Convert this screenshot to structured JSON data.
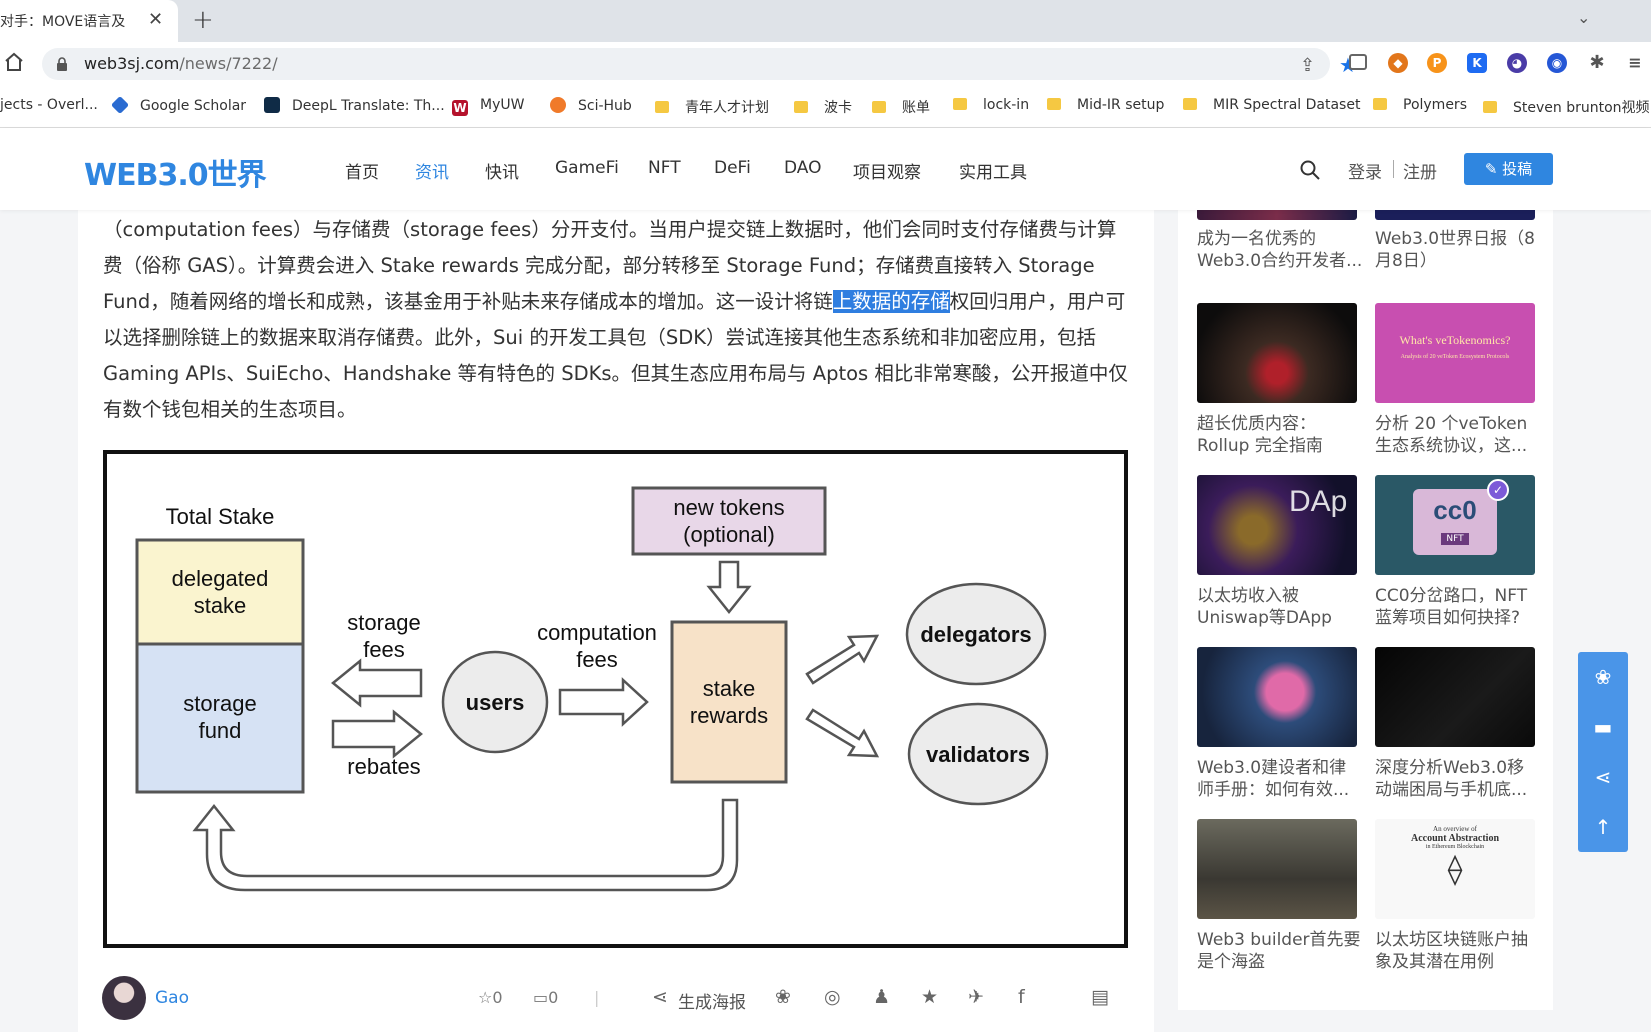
{
  "browser": {
    "tab_title": "对手：MOVE语言及",
    "url_domain": "web3sj.com",
    "url_path": "/news/7222/",
    "bookmarks": [
      "jects - Overl...",
      "Google Scholar",
      "DeepL Translate: Th...",
      "MyUW",
      "Sci-Hub",
      "青年人才计划",
      "波卡",
      "账单",
      "lock-in",
      "Mid-IR setup",
      "MIR Spectral Dataset",
      "Polymers",
      "Steven brunton视频"
    ]
  },
  "site": {
    "logo": "WEB3.0世界",
    "nav": [
      "首页",
      "资讯",
      "快讯",
      "GameFi",
      "NFT",
      "DeFi",
      "DAO",
      "项目观察",
      "实用工具"
    ],
    "login": "登录",
    "register": "注册",
    "submit": "投稿"
  },
  "article": {
    "p_before": "（computation fees）与存储费（storage fees）分开支付。当用户提交链上数据时，他们会同时支付存储费与计算费（俗称 GAS）。计算费会进入 Stake rewards 完成分配，部分转移至 Storage Fund；存储费直接转入 Storage Fund，随着网络的增长和成熟，该基金用于补贴未来存储成本的增加。这一设计将链",
    "p_highlight": "上数据的存储",
    "p_after": "权回归用户，用户可以选择删除链上的数据来取消存储费。此外，Sui 的开发工具包（SDK）尝试连接其他生态系统和非加密应用，包括 Gaming APIs、SuiEcho、Handshake 等有特色的 SDKs。但其生态应用布局与 Aptos 相比非常寒酸，公开报道中仅有数个钱包相关的生态项目。",
    "diagram": {
      "total_stake": "Total Stake",
      "delegated_1": "delegated",
      "delegated_2": "stake",
      "storage_1": "storage",
      "storage_2": "fund",
      "storage_fees_1": "storage",
      "storage_fees_2": "fees",
      "rebates": "rebates",
      "users": "users",
      "computation_1": "computation",
      "computation_2": "fees",
      "new_tokens_1": "new tokens",
      "new_tokens_2": "(optional)",
      "stake_rewards_1": "stake",
      "stake_rewards_2": "rewards",
      "delegators": "delegators",
      "validators": "validators"
    },
    "author": "Gao",
    "star_count": "0",
    "comment_count": "0",
    "poster": "生成海报"
  },
  "sidebar": {
    "top_cards": [
      "成为一名优秀的Web3.0合约开发者...",
      "Web3.0世界日报（8月8日）"
    ],
    "cards": [
      {
        "title": "超长优质内容：Rollup 完全指南"
      },
      {
        "title": "分析 20 个veToken 生态系统协议，这..."
      },
      {
        "title": "以太坊收入被Uniswap等DApp超..."
      },
      {
        "title": "CC0分岔路口，NFT蓝筹项目如何抉择?"
      },
      {
        "title": "Web3.0建设者和律师手册：如何有效..."
      },
      {
        "title": "深度分析Web3.0移动端困局与手机底..."
      },
      {
        "title": "Web3 builder首先要是个海盗"
      },
      {
        "title": "以太坊区块链账户抽象及其潜在用例"
      }
    ],
    "thumb_texts": {
      "vetoken_title": "What's veTokenomics?",
      "vetoken_sub": "Analysis of 20 veToken Ecosystem Protocols",
      "dapp": "DAp",
      "cc0": "cc0",
      "nft": "NFT",
      "aa_title": "An overview of",
      "aa_sub": "Account Abstraction",
      "aa_sub2": "in Ethereum Blockchain"
    }
  },
  "colors": {
    "accent": "#2f86e0",
    "highlight": "#2f7ee0"
  }
}
